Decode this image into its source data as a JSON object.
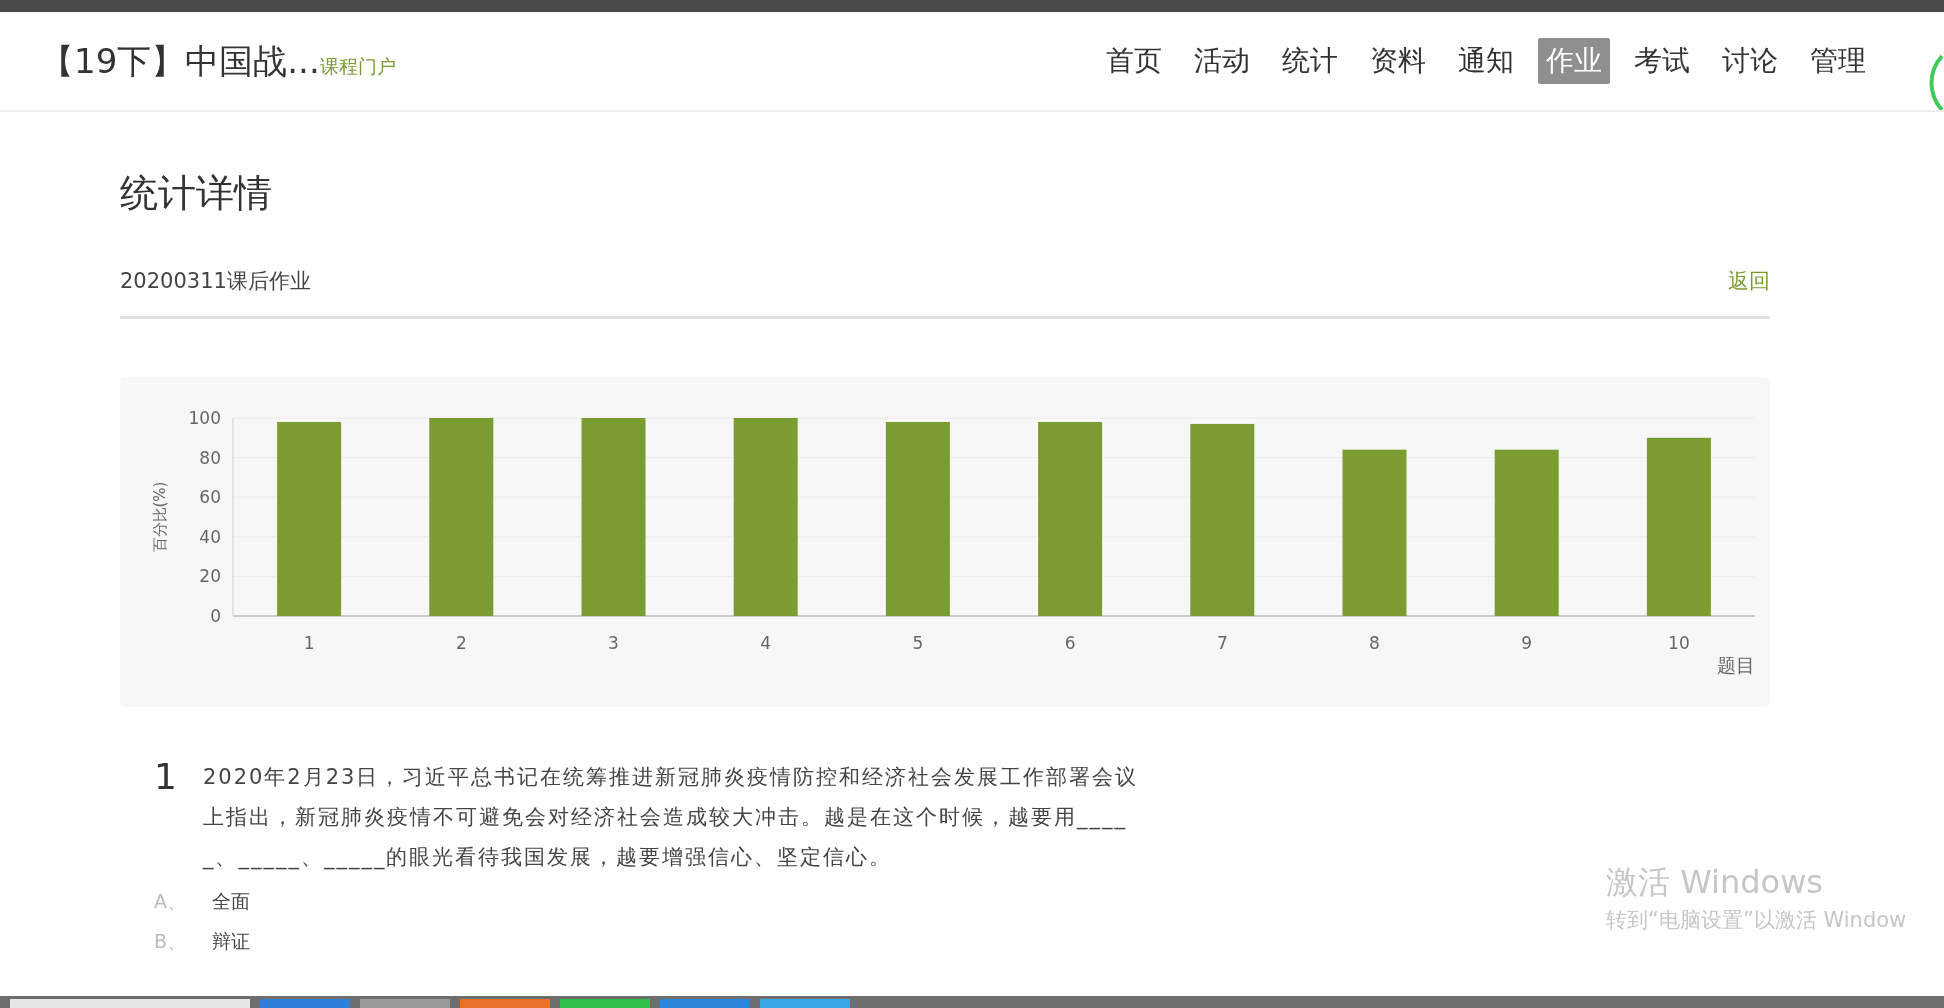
{
  "header": {
    "course_title": "【19下】中国战...",
    "portal_link": "课程门户",
    "nav": [
      {
        "label": "首页",
        "selected": false
      },
      {
        "label": "活动",
        "selected": false
      },
      {
        "label": "统计",
        "selected": false
      },
      {
        "label": "资料",
        "selected": false
      },
      {
        "label": "通知",
        "selected": false
      },
      {
        "label": "作业",
        "selected": true
      },
      {
        "label": "考试",
        "selected": false
      },
      {
        "label": "讨论",
        "selected": false
      },
      {
        "label": "管理",
        "selected": false
      }
    ]
  },
  "page_title": "统计详情",
  "assignment_name": "20200311课后作业",
  "back_link": "返回",
  "chart": {
    "chart_data": {
      "type": "bar",
      "xlabel": "题目",
      "ylabel": "百分比(%)",
      "categories": [
        "1",
        "2",
        "3",
        "4",
        "5",
        "6",
        "7",
        "8",
        "9",
        "10"
      ],
      "grid": true,
      "series": [
        {
          "color": "#7a9c31",
          "values": [
            98,
            100,
            100,
            100,
            98,
            98,
            97,
            84,
            84,
            90
          ]
        }
      ],
      "ylim": [
        0,
        100
      ],
      "yticks": [
        0,
        20,
        40,
        60,
        80,
        100
      ]
    }
  },
  "question": {
    "number": "1",
    "text": "2020年2月23日，习近平总书记在统筹推进新冠肺炎疫情防控和经济社会发展工作部署会议上指出，新冠肺炎疫情不可避免会对经济社会造成较大冲击。越是在这个时候，越要用_____、_____、_____的眼光看待我国发展，越要增强信心、坚定信心。",
    "options": [
      {
        "letter": "A、",
        "text": "全面"
      },
      {
        "letter": "B、",
        "text": "辩证"
      }
    ]
  },
  "activation_notice": {
    "title": "激活 Windows",
    "subtitle": "转到“电脑设置”以激活 Window"
  }
}
